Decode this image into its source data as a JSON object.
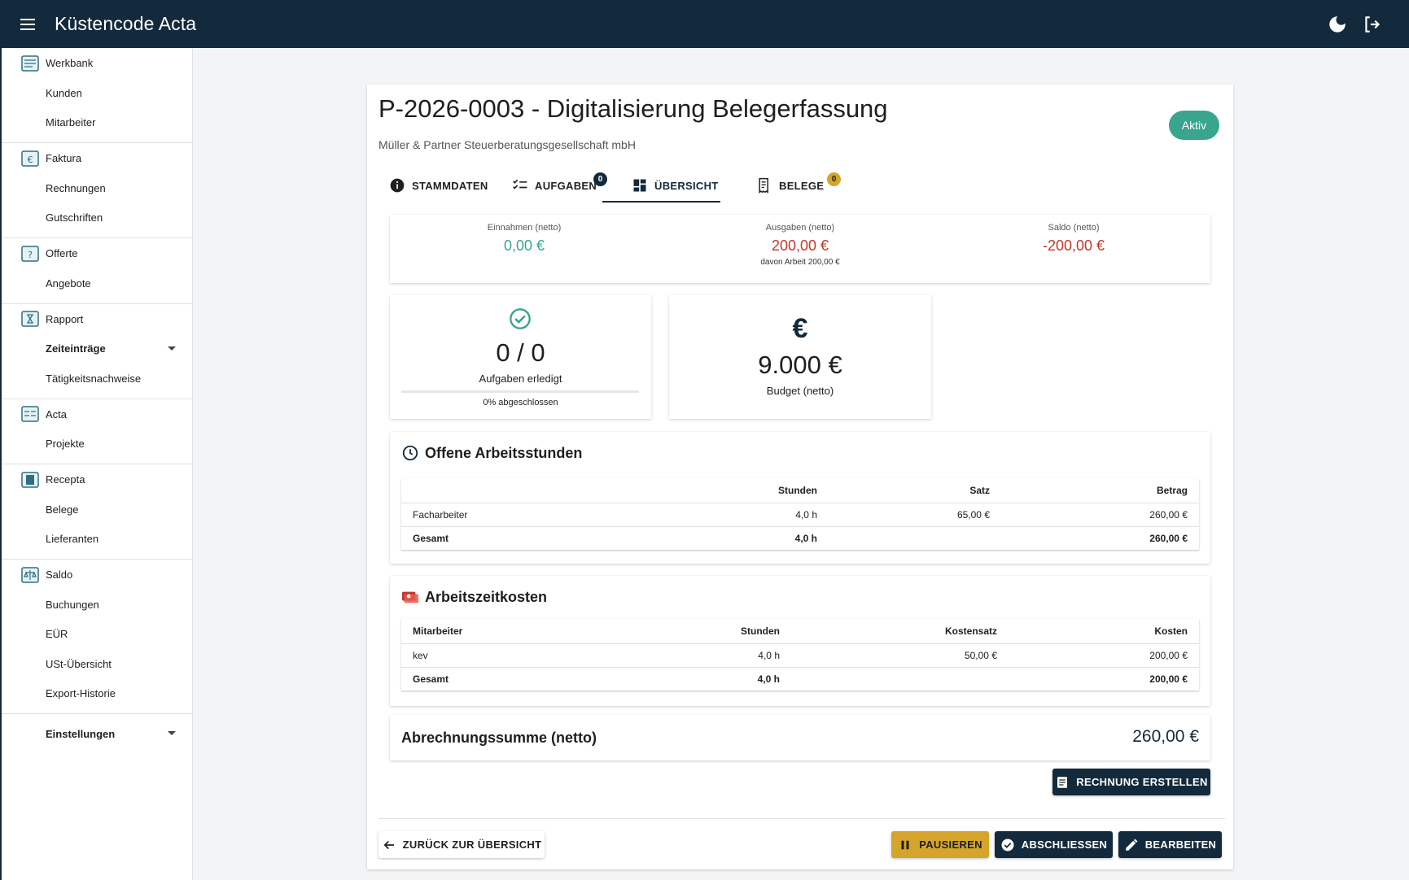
{
  "app": {
    "title": "Küstencode Acta"
  },
  "colors": {
    "topbar": "#132a3c",
    "accent_green": "#3aa58e",
    "negative_red": "#c0392b",
    "warning_yellow": "#d4a52a"
  },
  "sidebar": {
    "groups": [
      {
        "label": "Werkbank",
        "icon": "workbench-icon",
        "items": [
          "Kunden",
          "Mitarbeiter"
        ]
      },
      {
        "label": "Faktura",
        "icon": "invoice-icon",
        "items": [
          "Rechnungen",
          "Gutschriften"
        ]
      },
      {
        "label": "Offerte",
        "icon": "offer-icon",
        "items": [
          "Angebote"
        ]
      },
      {
        "label": "Rapport",
        "icon": "report-icon",
        "items": [
          "Zeiteinträge",
          "Tätigkeitsnachweise"
        ]
      },
      {
        "label": "Acta",
        "icon": "project-icon",
        "items": [
          "Projekte"
        ]
      },
      {
        "label": "Recepta",
        "icon": "receipt-icon",
        "items": [
          "Belege",
          "Lieferanten"
        ]
      },
      {
        "label": "Saldo",
        "icon": "balance-icon",
        "items": [
          "Buchungen",
          "EÜR",
          "USt-Übersicht",
          "Export-Historie"
        ]
      }
    ],
    "settings": "Einstellungen"
  },
  "project": {
    "title": "P-2026-0003 - Digitalisierung Belegerfassung",
    "client": "Müller & Partner Steuerberatungsgesellschaft mbH",
    "status": "Aktiv"
  },
  "tabs": [
    {
      "label": "STAMMDATEN"
    },
    {
      "label": "AUFGABEN",
      "badge": "0"
    },
    {
      "label": "ÜBERSICHT",
      "active": true
    },
    {
      "label": "BELEGE",
      "badge": "0"
    }
  ],
  "finance": {
    "income_label": "Einnahmen (netto)",
    "income_value": "0,00 €",
    "expense_label": "Ausgaben (netto)",
    "expense_value": "200,00 €",
    "expense_note": "davon Arbeit 200,00 €",
    "balance_label": "Saldo (netto)",
    "balance_value": "-200,00 €"
  },
  "tasks": {
    "count": "0 / 0",
    "label": "Aufgaben erledigt",
    "progress_pct": 0,
    "progress_text": "0% abgeschlossen"
  },
  "budget": {
    "symbol": "€",
    "value": "9.000 €",
    "label": "Budget (netto)"
  },
  "open_hours": {
    "title": "Offene Arbeitsstunden",
    "headers": [
      "",
      "Stunden",
      "Satz",
      "Betrag"
    ],
    "rows": [
      [
        "Facharbeiter",
        "4,0 h",
        "65,00 €",
        "260,00 €"
      ]
    ],
    "total": [
      "Gesamt",
      "4,0 h",
      "",
      "260,00 €"
    ]
  },
  "labor_costs": {
    "title": "Arbeitszeitkosten",
    "headers": [
      "Mitarbeiter",
      "Stunden",
      "Kostensatz",
      "Kosten"
    ],
    "rows": [
      [
        "kev",
        "4,0 h",
        "50,00 €",
        "200,00 €"
      ]
    ],
    "total": [
      "Gesamt",
      "4,0 h",
      "",
      "200,00 €"
    ]
  },
  "billing": {
    "label": "Abrechnungssumme (netto)",
    "value": "260,00 €"
  },
  "buttons": {
    "create_invoice": "RECHNUNG ERSTELLEN",
    "back": "ZURÜCK ZUR ÜBERSICHT",
    "pause": "PAUSIEREN",
    "complete": "ABSCHLIESSEN",
    "edit": "BEARBEITEN"
  }
}
